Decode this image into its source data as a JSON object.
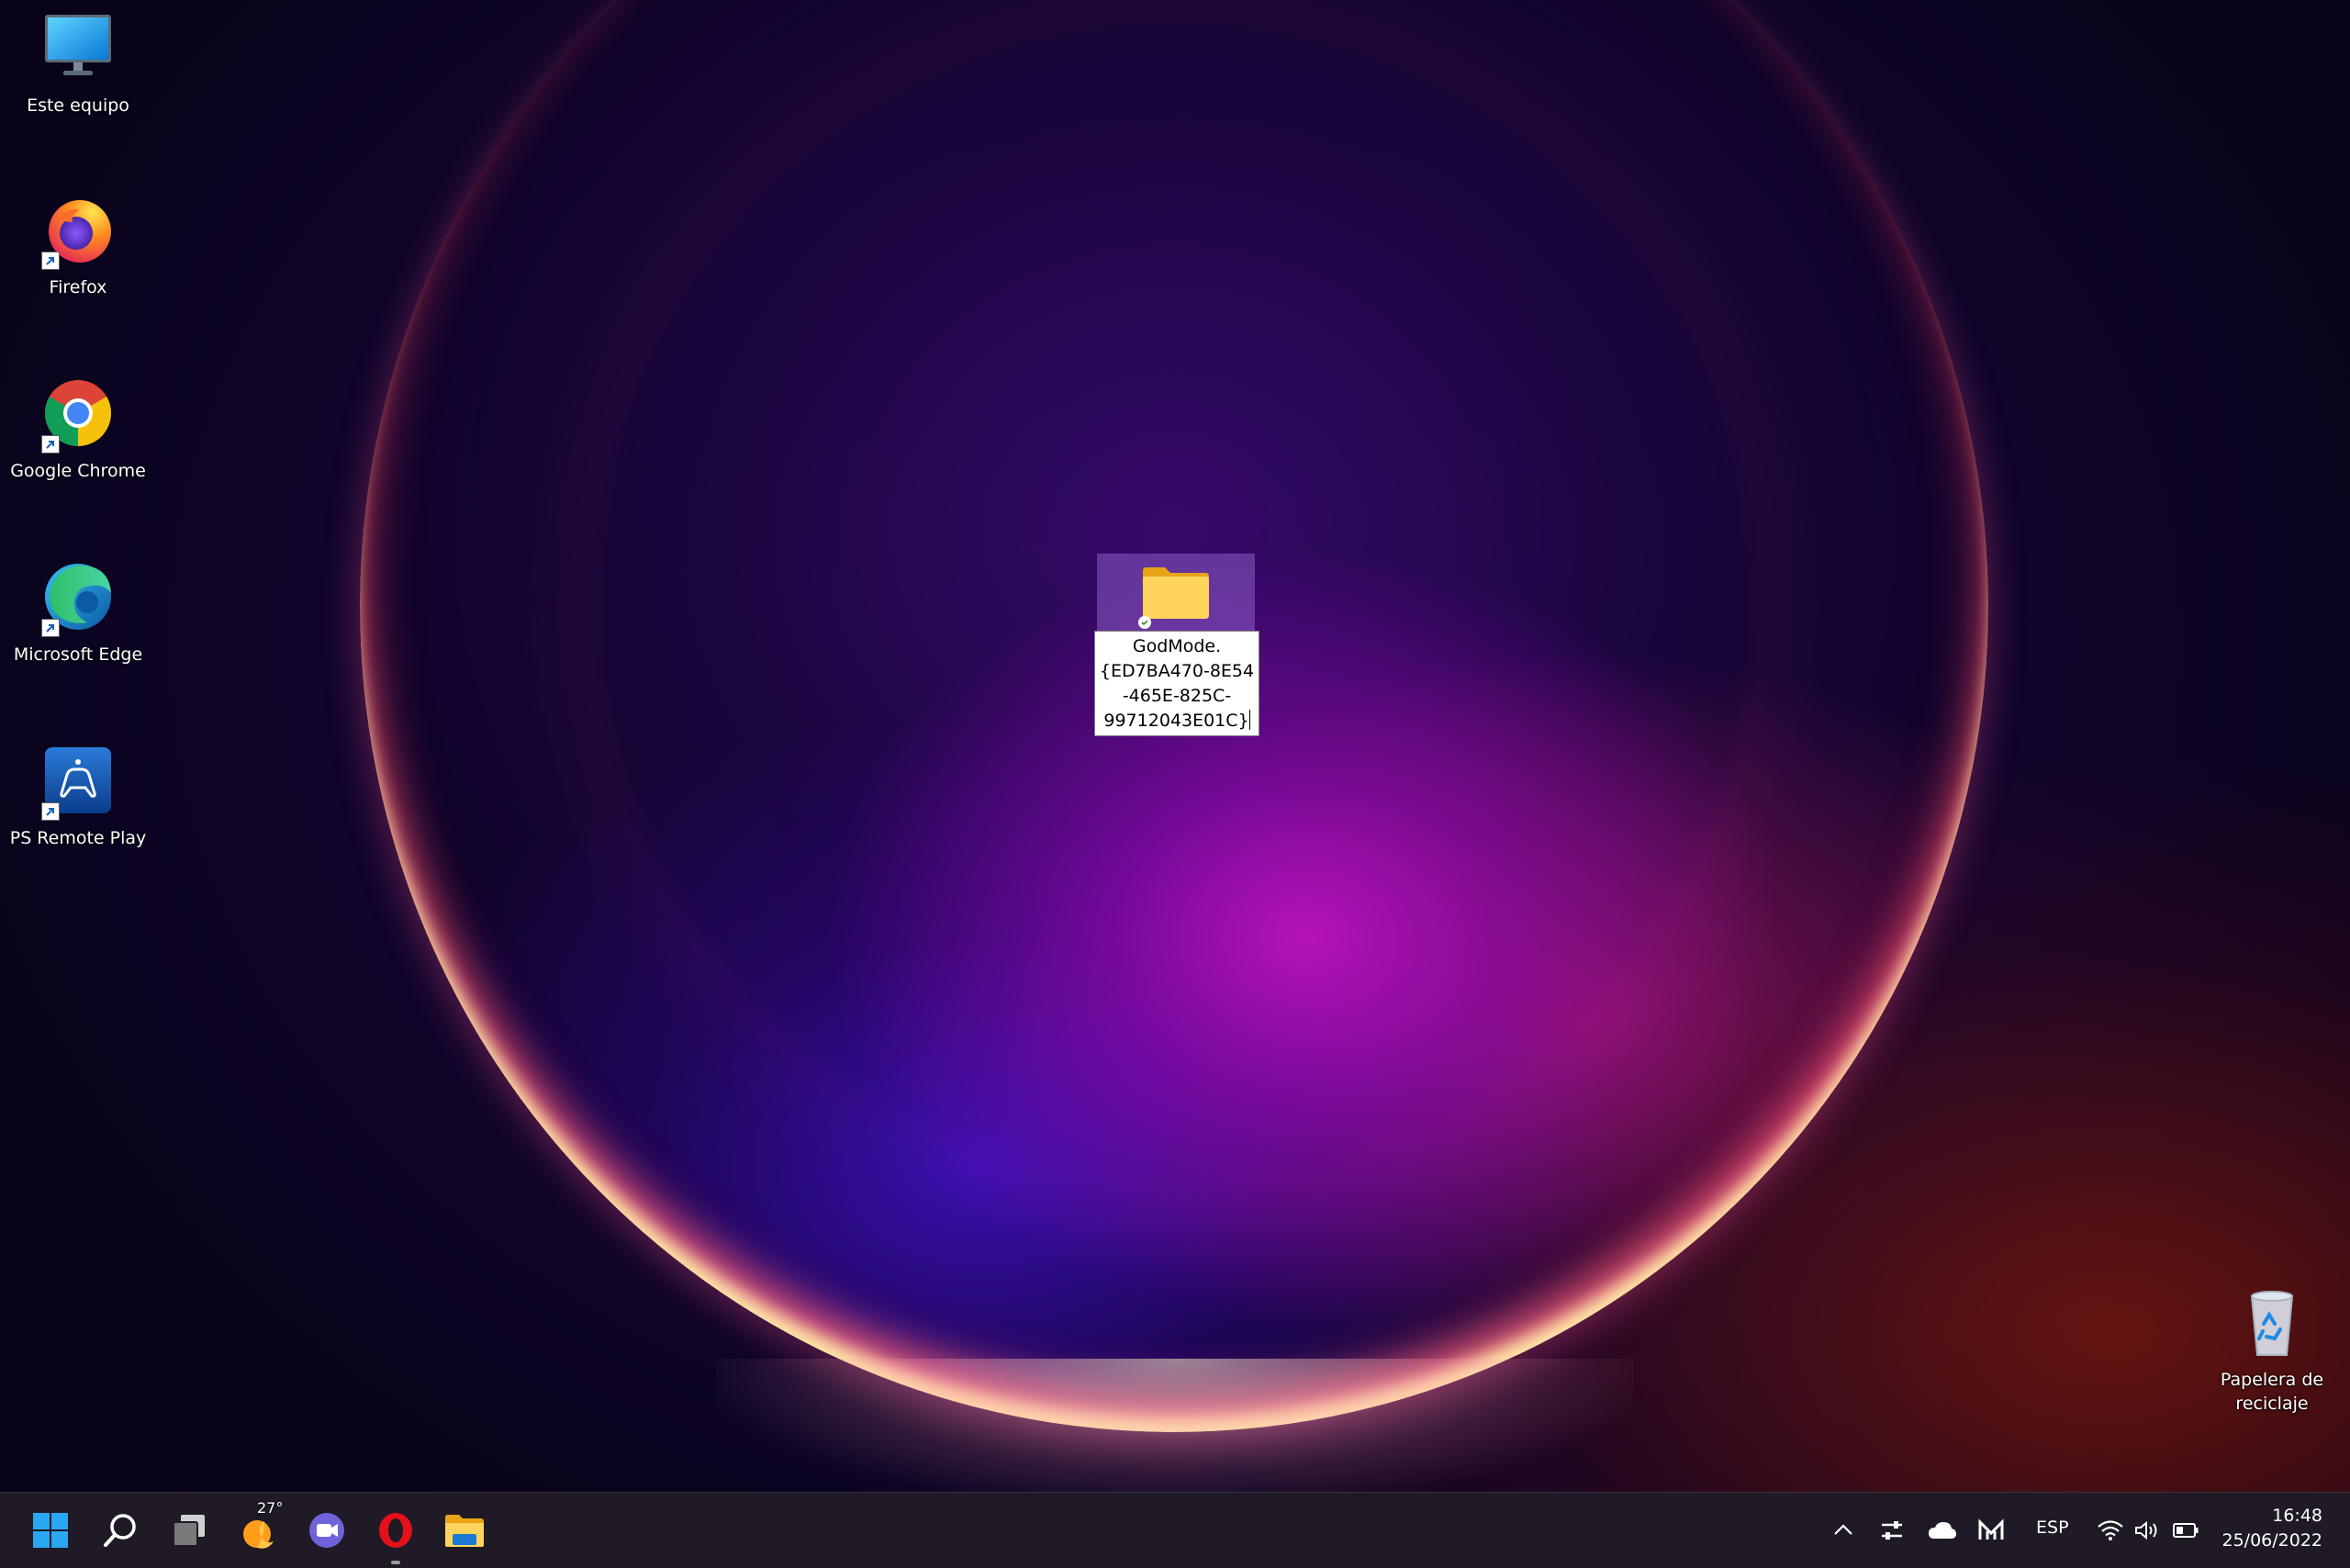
{
  "desktop": {
    "icons": [
      {
        "label": "Este equipo",
        "icon": "monitor-icon"
      },
      {
        "label": "Firefox",
        "icon": "firefox-icon"
      },
      {
        "label": "Google Chrome",
        "icon": "chrome-icon"
      },
      {
        "label": "Microsoft Edge",
        "icon": "edge-icon"
      },
      {
        "label": "PS Remote Play",
        "icon": "ps-remote-play-icon"
      }
    ],
    "recycle_bin": {
      "label_line1": "Papelera de",
      "label_line2": "reciclaje",
      "icon": "recycle-bin-icon"
    },
    "selected_folder": {
      "icon": "folder-icon",
      "rename_line1": "GodMode.",
      "rename_line2": "{ED7BA470-8E54",
      "rename_line3": "-465E-825C-",
      "rename_line4": "99712043E01C}"
    }
  },
  "taskbar": {
    "weather_temp": "27°",
    "language": "ESP",
    "time": "16:48",
    "date": "25/06/2022",
    "apps": [
      "start-icon",
      "search-icon",
      "task-view-icon",
      "weather-icon",
      "teams-chat-icon",
      "opera-icon",
      "file-explorer-icon"
    ]
  }
}
